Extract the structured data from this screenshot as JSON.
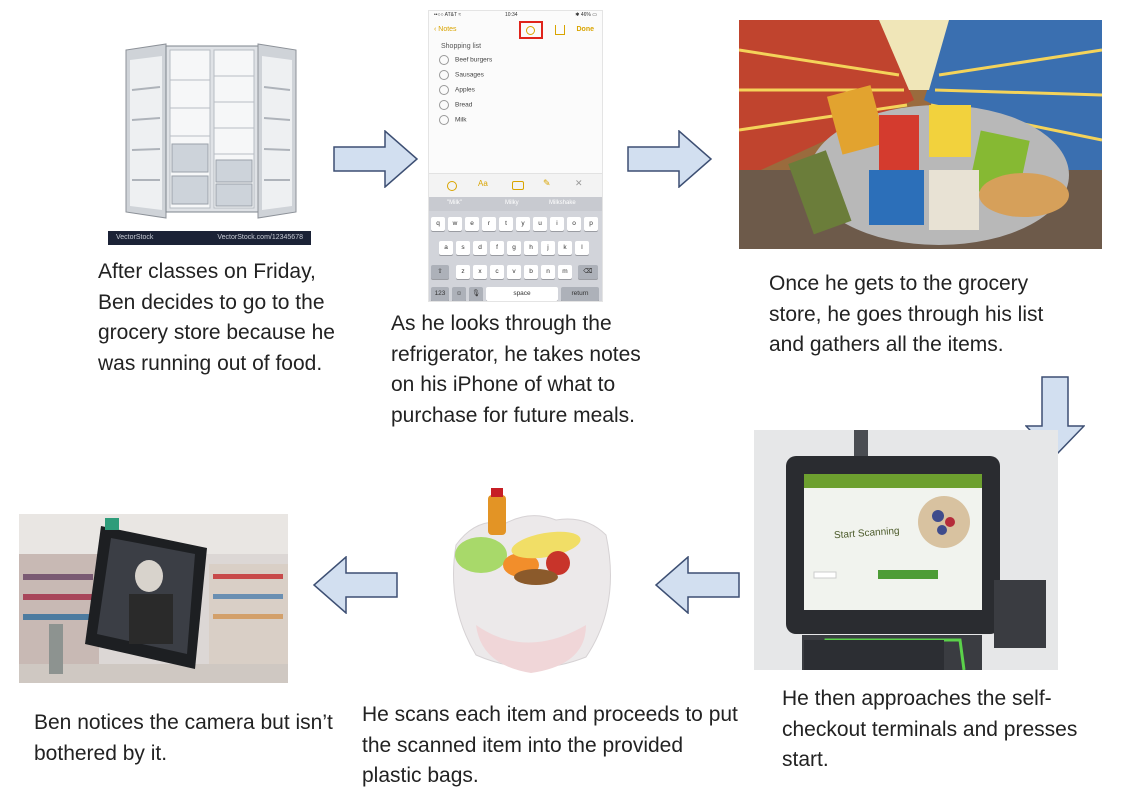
{
  "captions": {
    "step1": "After classes on Friday, Ben decides to go to the grocery store because he was running out of food.",
    "step2": "As he looks through the refrigerator, he takes notes on his iPhone of what to purchase for future meals.",
    "step3": "Once he gets to the grocery store, he goes through his list and gathers all the items.",
    "step4": "He then approaches the self-checkout terminals and presses start.",
    "step5": "He scans each item and proceeds to put the scanned item into the provided plastic bags.",
    "step6": "Ben notices the camera but isn’t bothered by it."
  },
  "fridge_bar": {
    "left": "VectorStock",
    "right": "VectorStock.com/12345678"
  },
  "phone": {
    "status_left": "••○○ AT&T ≈",
    "status_time": "10:34",
    "status_right": "✱ 46% ▭",
    "nav_back": "‹ Notes",
    "nav_done": "Done",
    "list_title": "Shopping list",
    "items": [
      "Beef burgers",
      "Sausages",
      "Apples",
      "Bread",
      "Milk"
    ],
    "predictions": [
      "\"Milk\"",
      "Milky",
      "Milkshake"
    ],
    "keys_row1": [
      "q",
      "w",
      "e",
      "r",
      "t",
      "y",
      "u",
      "i",
      "o",
      "p"
    ],
    "keys_row2": [
      "a",
      "s",
      "d",
      "f",
      "g",
      "h",
      "j",
      "k",
      "l"
    ],
    "keys_row3": [
      "z",
      "x",
      "c",
      "v",
      "b",
      "n",
      "m"
    ],
    "key_123": "123",
    "key_space": "space",
    "key_return": "return"
  },
  "kiosk": {
    "screen_text": "Start Scanning"
  },
  "colors": {
    "arrow_fill": "#d2dff0",
    "arrow_stroke": "#3d4f73",
    "highlight": "#e0241b"
  }
}
